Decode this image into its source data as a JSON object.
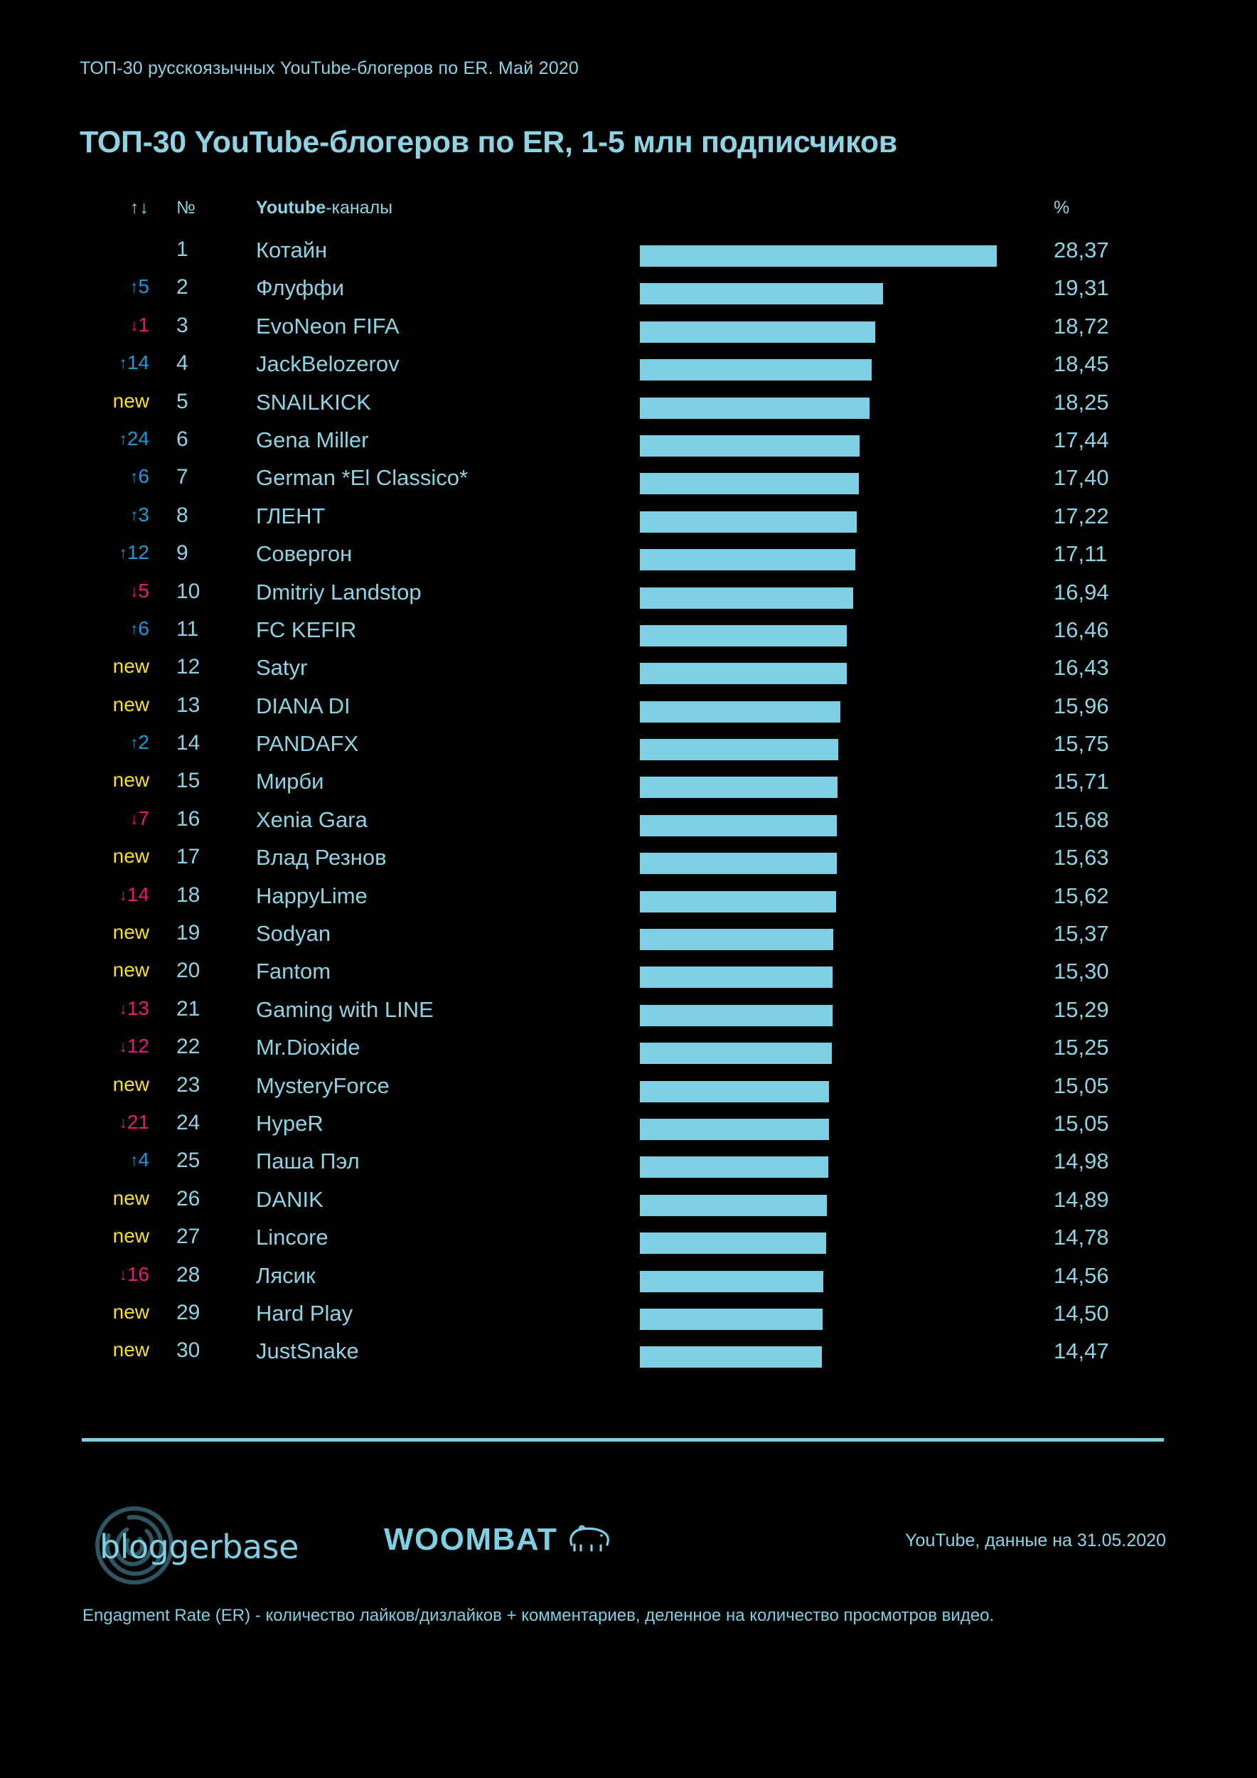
{
  "header": {
    "kicker": "ТОП-30 русскоязычных YouTube-блогеров по ER. Май 2020",
    "title": "ТОП-30 YouTube-блогеров по ER, 1-5 млн подписчиков"
  },
  "table": {
    "columns": {
      "delta": "↑↓",
      "rank": "№",
      "name_bold": "Youtube",
      "name_rest": "-каналы",
      "percent": "%"
    }
  },
  "colors": {
    "background": "#000000",
    "accent": "#8ed3e3",
    "bar": "#7ecfe3",
    "up": "#1b9ad6",
    "down": "#e6197c",
    "new": "#f7e029"
  },
  "footer": {
    "logo_bloggerbase": "bloggerbase",
    "logo_woombat": "WOOMBAT",
    "source_note": "YouTube, данные на 31.05.2020",
    "footnote": "Engagment Rate (ER) - количество лайков/дизлайков + комментариев, деленное на количество просмотров видео."
  },
  "chart_data": {
    "type": "bar",
    "title": "ТОП-30 YouTube-блогеров по ER, 1-5 млн подписчиков",
    "xlabel": "",
    "ylabel": "",
    "xlim": [
      0,
      28.37
    ],
    "grid": false,
    "legend": false,
    "orientation": "horizontal",
    "value_suffix": "%",
    "categories": [
      "Котайн",
      "Флуффи",
      "EvoNeon FIFA",
      "JackBelozerov",
      "SNAILKICK",
      "Gena Miller",
      "German *El Classico*",
      "ГЛЕНТ",
      "Совергон",
      "Dmitriy Landstop",
      "FC KEFIR",
      "Satyr",
      "DIANA DI",
      "PANDAFX",
      "Мирби",
      "Xenia Gara",
      "Влад Резнов",
      "HappyLime",
      "Sodyan",
      "Fantom",
      "Gaming with LINE",
      "Mr.Dioxide",
      "MysteryForce",
      "HypeR",
      "Паша Пэл",
      "DANIK",
      "Lincore",
      "Лясик",
      "Hard Play",
      "JustSnake"
    ],
    "values": [
      28.37,
      19.31,
      18.72,
      18.45,
      18.25,
      17.44,
      17.4,
      17.22,
      17.11,
      16.94,
      16.46,
      16.43,
      15.96,
      15.75,
      15.71,
      15.68,
      15.63,
      15.62,
      15.37,
      15.3,
      15.29,
      15.25,
      15.05,
      15.05,
      14.98,
      14.89,
      14.78,
      14.56,
      14.5,
      14.47
    ],
    "value_labels": [
      "28,37",
      "19,31",
      "18,72",
      "18,45",
      "18,25",
      "17,44",
      "17,40",
      "17,22",
      "17,11",
      "16,94",
      "16,46",
      "16,43",
      "15,96",
      "15,75",
      "15,71",
      "15,68",
      "15,63",
      "15,62",
      "15,37",
      "15,30",
      "15,29",
      "15,25",
      "15,05",
      "15,05",
      "14,98",
      "14,89",
      "14,78",
      "14,56",
      "14,50",
      "14,47"
    ]
  },
  "rows": [
    {
      "rank": "1",
      "delta": "",
      "delta_type": "none",
      "name": "Котайн",
      "percent": "28,37",
      "value": 28.37
    },
    {
      "rank": "2",
      "delta": "5",
      "delta_type": "up",
      "name": "Флуффи",
      "percent": "19,31",
      "value": 19.31
    },
    {
      "rank": "3",
      "delta": "1",
      "delta_type": "down",
      "name": "EvoNeon FIFA",
      "percent": "18,72",
      "value": 18.72
    },
    {
      "rank": "4",
      "delta": "14",
      "delta_type": "up",
      "name": "JackBelozerov",
      "percent": "18,45",
      "value": 18.45
    },
    {
      "rank": "5",
      "delta": "new",
      "delta_type": "new",
      "name": "SNAILKICK",
      "percent": "18,25",
      "value": 18.25
    },
    {
      "rank": "6",
      "delta": "24",
      "delta_type": "up",
      "name": "Gena Miller",
      "percent": "17,44",
      "value": 17.44
    },
    {
      "rank": "7",
      "delta": "6",
      "delta_type": "up",
      "name": "German *El Classico*",
      "percent": "17,40",
      "value": 17.4
    },
    {
      "rank": "8",
      "delta": "3",
      "delta_type": "up",
      "name": "ГЛЕНТ",
      "percent": "17,22",
      "value": 17.22
    },
    {
      "rank": "9",
      "delta": "12",
      "delta_type": "up",
      "name": "Совергон",
      "percent": "17,11",
      "value": 17.11
    },
    {
      "rank": "10",
      "delta": "5",
      "delta_type": "down",
      "name": "Dmitriy Landstop",
      "percent": "16,94",
      "value": 16.94
    },
    {
      "rank": "11",
      "delta": "6",
      "delta_type": "up",
      "name": "FC KEFIR",
      "percent": "16,46",
      "value": 16.46
    },
    {
      "rank": "12",
      "delta": "new",
      "delta_type": "new",
      "name": "Satyr",
      "percent": "16,43",
      "value": 16.43
    },
    {
      "rank": "13",
      "delta": "new",
      "delta_type": "new",
      "name": "DIANA DI",
      "percent": "15,96",
      "value": 15.96
    },
    {
      "rank": "14",
      "delta": "2",
      "delta_type": "up",
      "name": "PANDAFX",
      "percent": "15,75",
      "value": 15.75
    },
    {
      "rank": "15",
      "delta": "new",
      "delta_type": "new",
      "name": "Мирби",
      "percent": "15,71",
      "value": 15.71
    },
    {
      "rank": "16",
      "delta": "7",
      "delta_type": "down",
      "name": "Xenia Gara",
      "percent": "15,68",
      "value": 15.68
    },
    {
      "rank": "17",
      "delta": "new",
      "delta_type": "new",
      "name": "Влад Резнов",
      "percent": "15,63",
      "value": 15.63
    },
    {
      "rank": "18",
      "delta": "14",
      "delta_type": "down",
      "name": "HappyLime",
      "percent": "15,62",
      "value": 15.62
    },
    {
      "rank": "19",
      "delta": "new",
      "delta_type": "new",
      "name": "Sodyan",
      "percent": "15,37",
      "value": 15.37
    },
    {
      "rank": "20",
      "delta": "new",
      "delta_type": "new",
      "name": "Fantom",
      "percent": "15,30",
      "value": 15.3
    },
    {
      "rank": "21",
      "delta": "13",
      "delta_type": "down",
      "name": "Gaming with LINE",
      "percent": "15,29",
      "value": 15.29
    },
    {
      "rank": "22",
      "delta": "12",
      "delta_type": "down",
      "name": "Mr.Dioxide",
      "percent": "15,25",
      "value": 15.25
    },
    {
      "rank": "23",
      "delta": "new",
      "delta_type": "new",
      "name": "MysteryForce",
      "percent": "15,05",
      "value": 15.05
    },
    {
      "rank": "24",
      "delta": "21",
      "delta_type": "down",
      "name": "HypeR",
      "percent": "15,05",
      "value": 15.05
    },
    {
      "rank": "25",
      "delta": "4",
      "delta_type": "up",
      "name": "Паша Пэл",
      "percent": "14,98",
      "value": 14.98
    },
    {
      "rank": "26",
      "delta": "new",
      "delta_type": "new",
      "name": "DANIK",
      "percent": "14,89",
      "value": 14.89
    },
    {
      "rank": "27",
      "delta": "new",
      "delta_type": "new",
      "name": "Lincore",
      "percent": "14,78",
      "value": 14.78
    },
    {
      "rank": "28",
      "delta": "16",
      "delta_type": "down",
      "name": "Лясик",
      "percent": "14,56",
      "value": 14.56
    },
    {
      "rank": "29",
      "delta": "new",
      "delta_type": "new",
      "name": "Hard Play",
      "percent": "14,50",
      "value": 14.5
    },
    {
      "rank": "30",
      "delta": "new",
      "delta_type": "new",
      "name": "JustSnake",
      "percent": "14,47",
      "value": 14.47
    }
  ]
}
